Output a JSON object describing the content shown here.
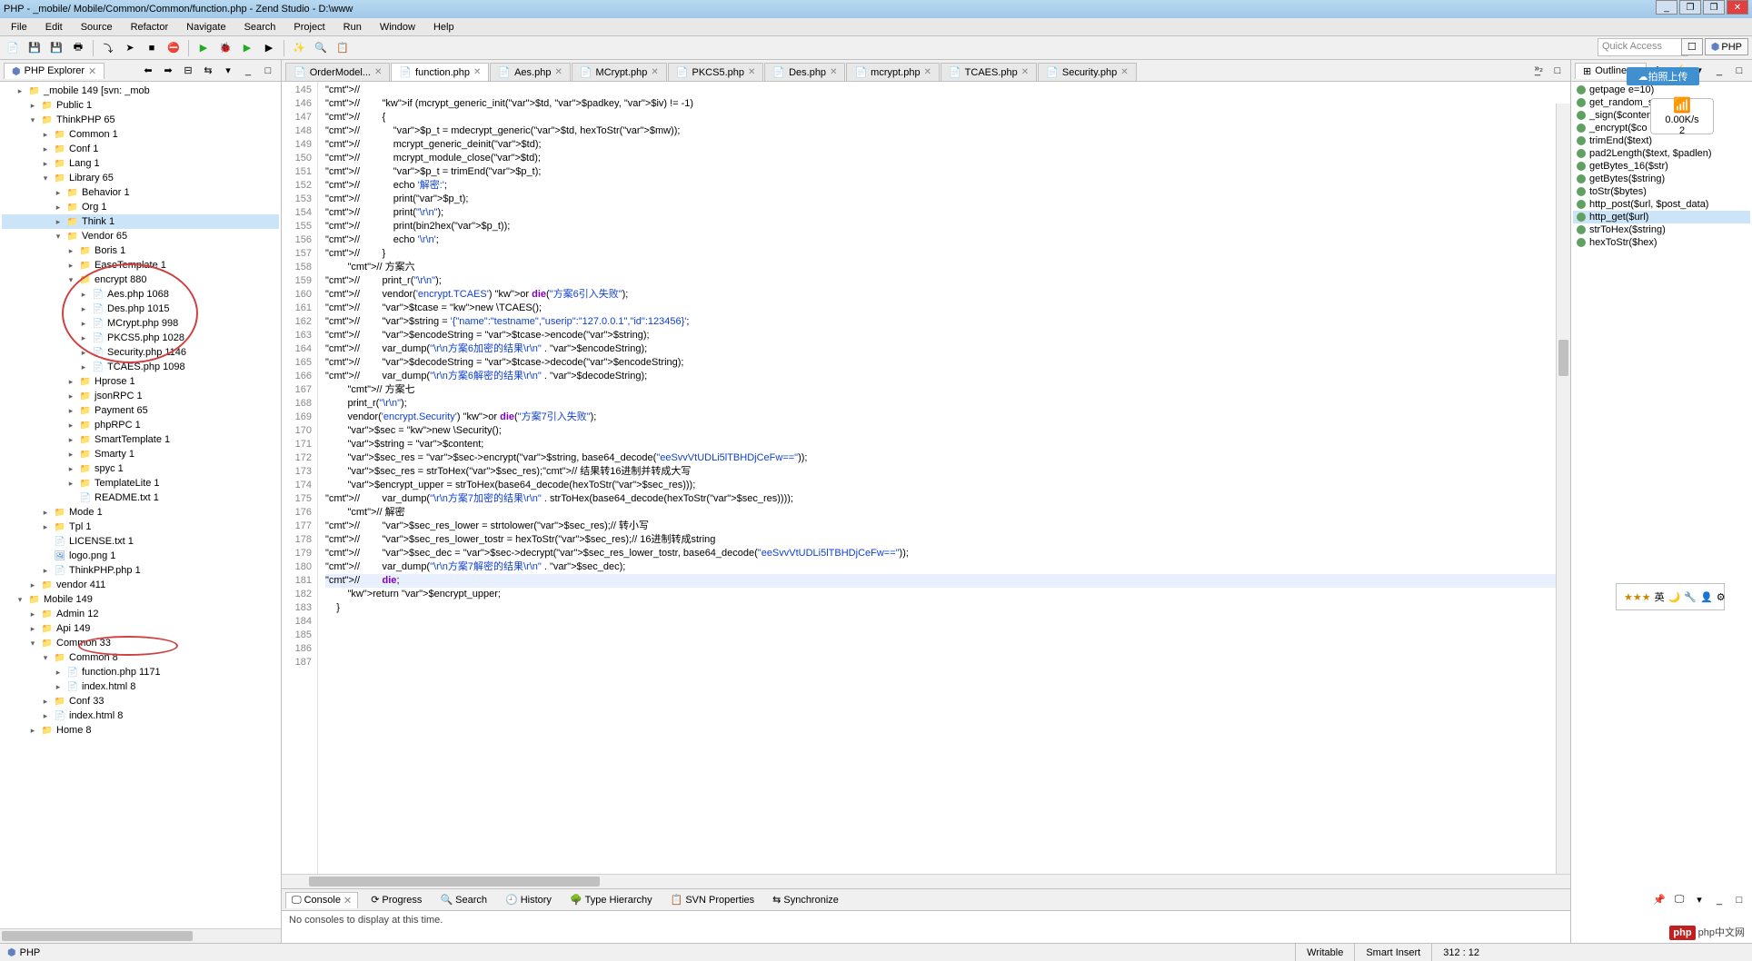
{
  "window": {
    "title": "PHP - _mobile/ Mobile/Common/Common/function.php - Zend Studio - D:\\www",
    "controls": {
      "min": "_",
      "max1": "❐",
      "max2": "❐",
      "close": "✕"
    }
  },
  "menu": [
    "File",
    "Edit",
    "Source",
    "Refactor",
    "Navigate",
    "Search",
    "Project",
    "Run",
    "Window",
    "Help"
  ],
  "quick_access": "Quick Access",
  "perspective": {
    "open": "☐",
    "php": "PHP"
  },
  "explorer": {
    "title": "PHP Explorer",
    "tree": [
      {
        "d": 1,
        "t": ">",
        "i": "proj",
        "l": "_mobile 149 [svn:                                _mob"
      },
      {
        "d": 2,
        "t": ">",
        "i": "fld",
        "l": "Public 1"
      },
      {
        "d": 2,
        "t": "v",
        "i": "fld",
        "l": "ThinkPHP 65"
      },
      {
        "d": 3,
        "t": ">",
        "i": "fld",
        "l": "Common 1"
      },
      {
        "d": 3,
        "t": ">",
        "i": "fld",
        "l": "Conf 1"
      },
      {
        "d": 3,
        "t": ">",
        "i": "fld",
        "l": "Lang 1"
      },
      {
        "d": 3,
        "t": "v",
        "i": "fld",
        "l": "Library 65"
      },
      {
        "d": 4,
        "t": ">",
        "i": "fld",
        "l": "Behavior 1"
      },
      {
        "d": 4,
        "t": ">",
        "i": "fld",
        "l": "Org 1"
      },
      {
        "d": 4,
        "t": ">",
        "i": "fld",
        "l": "Think 1",
        "sel": true
      },
      {
        "d": 4,
        "t": "v",
        "i": "fld",
        "l": "Vendor 65"
      },
      {
        "d": 5,
        "t": ">",
        "i": "fld",
        "l": "Boris 1"
      },
      {
        "d": 5,
        "t": ">",
        "i": "fld",
        "l": "EaseTemplate 1"
      },
      {
        "d": 5,
        "t": "v",
        "i": "fld",
        "l": "encrypt 880"
      },
      {
        "d": 6,
        "t": ">",
        "i": "php",
        "l": "Aes.php 1068"
      },
      {
        "d": 6,
        "t": ">",
        "i": "php",
        "l": "Des.php 1015"
      },
      {
        "d": 6,
        "t": ">",
        "i": "php",
        "l": "MCrypt.php 998"
      },
      {
        "d": 6,
        "t": ">",
        "i": "php",
        "l": "PKCS5.php 1028"
      },
      {
        "d": 6,
        "t": ">",
        "i": "php",
        "l": "Security.php 1146"
      },
      {
        "d": 6,
        "t": ">",
        "i": "php",
        "l": "TCAES.php 1098"
      },
      {
        "d": 5,
        "t": ">",
        "i": "fld",
        "l": "Hprose 1"
      },
      {
        "d": 5,
        "t": ">",
        "i": "fld",
        "l": "jsonRPC 1"
      },
      {
        "d": 5,
        "t": ">",
        "i": "fld",
        "l": "Payment 65"
      },
      {
        "d": 5,
        "t": ">",
        "i": "fld",
        "l": "phpRPC 1"
      },
      {
        "d": 5,
        "t": ">",
        "i": "fld",
        "l": "SmartTemplate 1"
      },
      {
        "d": 5,
        "t": ">",
        "i": "fld",
        "l": "Smarty 1"
      },
      {
        "d": 5,
        "t": ">",
        "i": "fld",
        "l": "spyc 1"
      },
      {
        "d": 5,
        "t": ">",
        "i": "fld",
        "l": "TemplateLite 1"
      },
      {
        "d": 5,
        "t": "",
        "i": "txt",
        "l": "README.txt 1"
      },
      {
        "d": 3,
        "t": ">",
        "i": "fld",
        "l": "Mode 1"
      },
      {
        "d": 3,
        "t": ">",
        "i": "fld",
        "l": "Tpl 1"
      },
      {
        "d": 3,
        "t": "",
        "i": "txt",
        "l": "LICENSE.txt 1"
      },
      {
        "d": 3,
        "t": "",
        "i": "img",
        "l": "logo.png 1"
      },
      {
        "d": 3,
        "t": ">",
        "i": "php",
        "l": "ThinkPHP.php 1"
      },
      {
        "d": 2,
        "t": ">",
        "i": "fld",
        "l": "vendor 411"
      },
      {
        "d": 1,
        "t": "v",
        "i": "proj",
        "l": "Mobile 149"
      },
      {
        "d": 2,
        "t": ">",
        "i": "fld",
        "l": "Admin 12"
      },
      {
        "d": 2,
        "t": ">",
        "i": "fld",
        "l": "Api 149"
      },
      {
        "d": 2,
        "t": "v",
        "i": "fld",
        "l": "Common 33"
      },
      {
        "d": 3,
        "t": "v",
        "i": "fld",
        "l": "Common 8"
      },
      {
        "d": 4,
        "t": ">",
        "i": "php",
        "l": "function.php 1171"
      },
      {
        "d": 4,
        "t": ">",
        "i": "php",
        "l": "index.html 8"
      },
      {
        "d": 3,
        "t": ">",
        "i": "fld",
        "l": "Conf 33"
      },
      {
        "d": 3,
        "t": ">",
        "i": "php",
        "l": "index.html 8"
      },
      {
        "d": 2,
        "t": ">",
        "i": "fld",
        "l": "Home 8"
      }
    ]
  },
  "editor": {
    "tabs": [
      {
        "label": "OrderModel..."
      },
      {
        "label": "function.php",
        "active": true
      },
      {
        "label": "Aes.php"
      },
      {
        "label": "MCrypt.php"
      },
      {
        "label": "PKCS5.php"
      },
      {
        "label": "Des.php"
      },
      {
        "label": "mcrypt.php"
      },
      {
        "label": "TCAES.php"
      },
      {
        "label": "Security.php"
      }
    ],
    "overflow": "»₂",
    "first_line": 145,
    "lines": [
      "//",
      "//        if (mcrypt_generic_init($td, $padkey, $iv) != -1)",
      "//        {",
      "//            $p_t = mdecrypt_generic($td, hexToStr($mw));",
      "//            mcrypt_generic_deinit($td);",
      "//            mcrypt_module_close($td);",
      "",
      "//            $p_t = trimEnd($p_t);",
      "//            echo '解密:';",
      "//            print($p_t);",
      "//            print(\"\\r\\n\");",
      "//            print(bin2hex($p_t));",
      "//            echo '\\r\\n';",
      "//        }",
      "",
      "        // 方案六",
      "//        print_r(\"\\r\\n\");",
      "//        vendor('encrypt.TCAES') or die(\"方案6引入失败\");",
      "//        $tcase = new \\TCAES();",
      "//        $string = '{\"name\":\"testname\",\"userip\":\"127.0.0.1\",\"id\":123456}';",
      "//        $encodeString = $tcase->encode($string);",
      "//        var_dump(\"\\r\\n方案6加密的结果\\r\\n\" . $encodeString);",
      "//        $decodeString = $tcase->decode($encodeString);",
      "//        var_dump(\"\\r\\n方案6解密的结果\\r\\n\" . $decodeString);",
      "",
      "        // 方案七",
      "        print_r(\"\\r\\n\");",
      "        vendor('encrypt.Security') or die(\"方案7引入失败\");",
      "        $sec = new \\Security();",
      "        $string = $content;",
      "        $sec_res = $sec->encrypt($string, base64_decode(\"eeSvvVtUDLi5lTBHDjCeFw==\"));",
      "        $sec_res = strToHex($sec_res);// 结果转16进制并转成大写",
      "        $encrypt_upper = strToHex(base64_decode(hexToStr($sec_res)));",
      "//        var_dump(\"\\r\\n方案7加密的结果\\r\\n\" . strToHex(base64_decode(hexToStr($sec_res))));",
      "        // 解密",
      "//        $sec_res_lower = strtolower($sec_res);// 转小写",
      "//        $sec_res_lower_tostr = hexToStr($sec_res);// 16进制转成string",
      "//        $sec_dec = $sec->decrypt($sec_res_lower_tostr, base64_decode(\"eeSvvVtUDLi5lTBHDjCeFw==\"));",
      "//        var_dump(\"\\r\\n方案7解密的结果\\r\\n\" . $sec_dec);",
      "//        die;",
      "        return $encrypt_upper;",
      "",
      "    }"
    ]
  },
  "bottom": {
    "tabs": [
      "Console",
      "Progress",
      "Search",
      "History",
      "Type Hierarchy",
      "SVN Properties",
      "Synchronize"
    ],
    "message": "No consoles to display at this time."
  },
  "outline": {
    "title": "Outline",
    "items": [
      "getpage                e=10)",
      "get_random_string($size)",
      "_sign($conten",
      "_encrypt($co",
      "trimEnd($text)",
      "pad2Length($text, $padlen)",
      "getBytes_16($str)",
      "getBytes($string)",
      "toStr($bytes)",
      "http_post($url, $post_data)",
      "http_get($url)",
      "strToHex($string)",
      "hexToStr($hex)"
    ],
    "selected": 10
  },
  "status": {
    "left": "PHP",
    "writable": "Writable",
    "insert": "Smart Insert",
    "pos": "312 : 12"
  },
  "widgets": {
    "cloud": "拍照上传",
    "wifi_speed": "0.00K/s",
    "wifi_count": "2",
    "ime": "英",
    "logo": "php中文网"
  }
}
